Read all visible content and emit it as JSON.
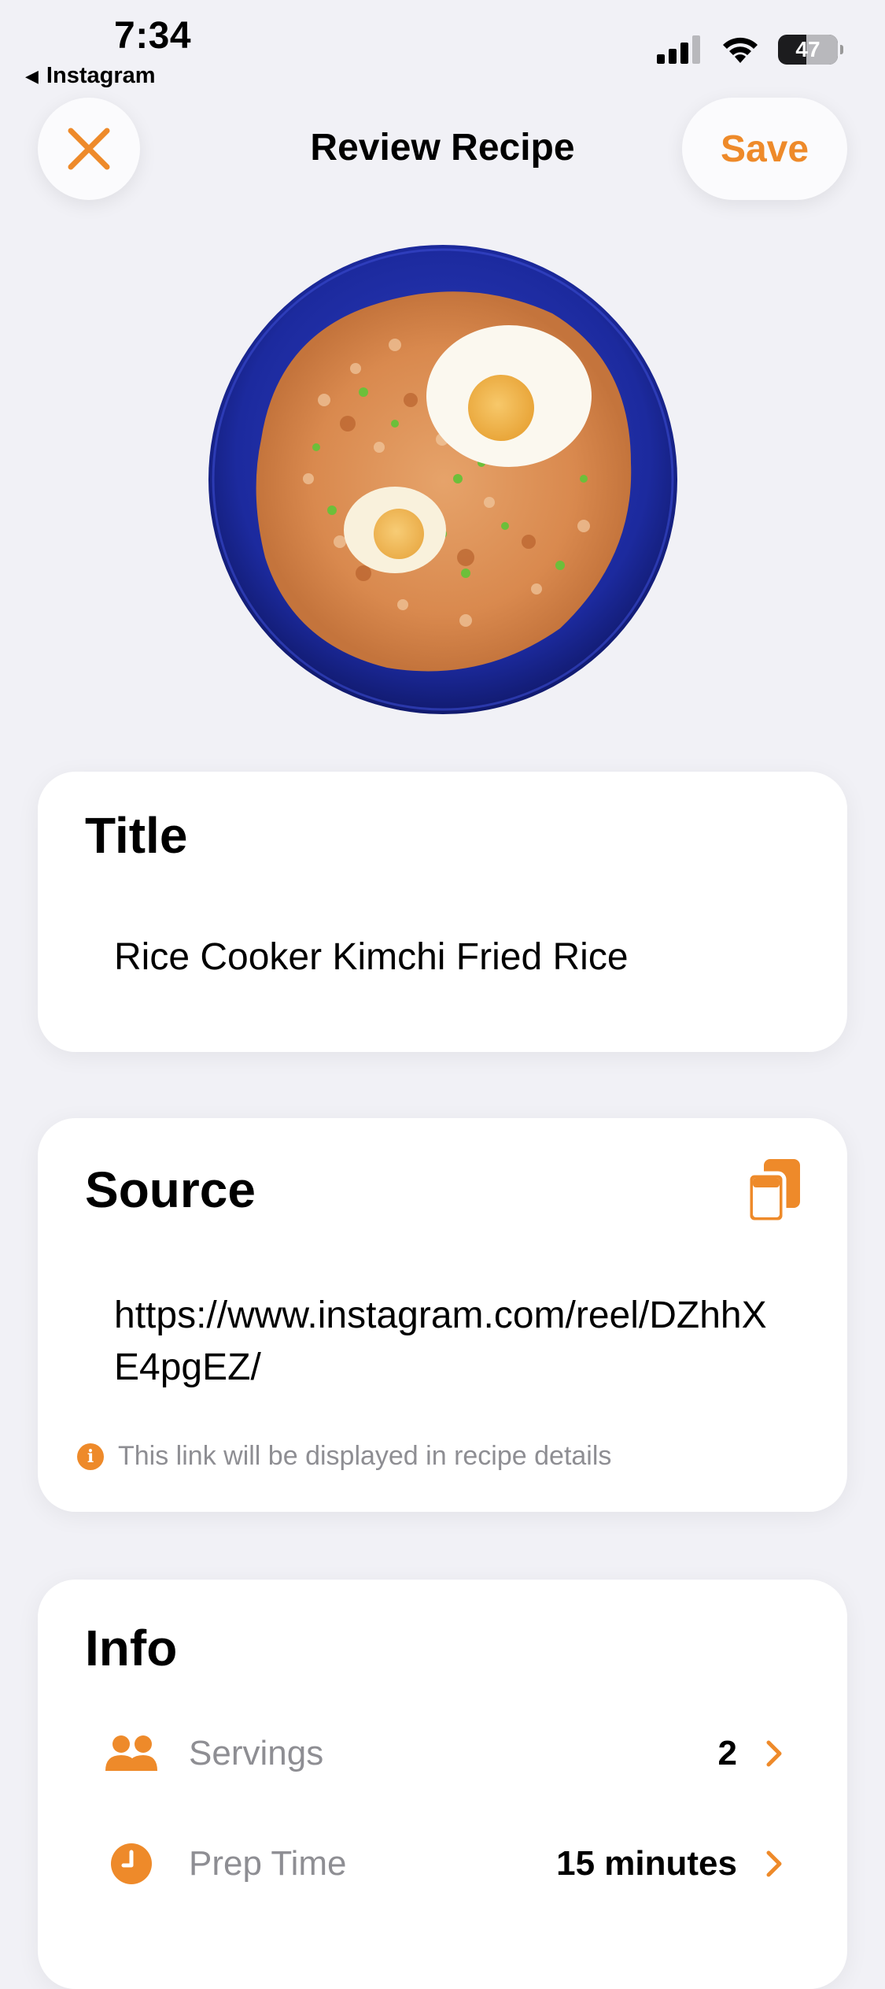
{
  "status_bar": {
    "time": "7:34",
    "back_app": "Instagram",
    "battery_level": "47",
    "battery_fraction": 0.47
  },
  "nav": {
    "title": "Review Recipe",
    "save_label": "Save",
    "close_icon": "close-x-icon"
  },
  "colors": {
    "accent": "#ee8a2a",
    "background": "#f1f1f6",
    "card": "#ffffff",
    "secondary_text": "#8e8e93"
  },
  "title_section": {
    "heading": "Title",
    "value": "Rice Cooker Kimchi Fried Rice"
  },
  "source_section": {
    "heading": "Source",
    "url": "https://www.instagram.com/reel/DZhhXE4pgEZ/",
    "note": "This link will be displayed in recipe details",
    "copy_icon": "copy-icon",
    "info_icon": "info-icon"
  },
  "info_section": {
    "heading": "Info",
    "rows": [
      {
        "icon": "people-icon",
        "label": "Servings",
        "value": "2"
      },
      {
        "icon": "clock-icon",
        "label": "Prep Time",
        "value": "15 minutes"
      }
    ]
  }
}
